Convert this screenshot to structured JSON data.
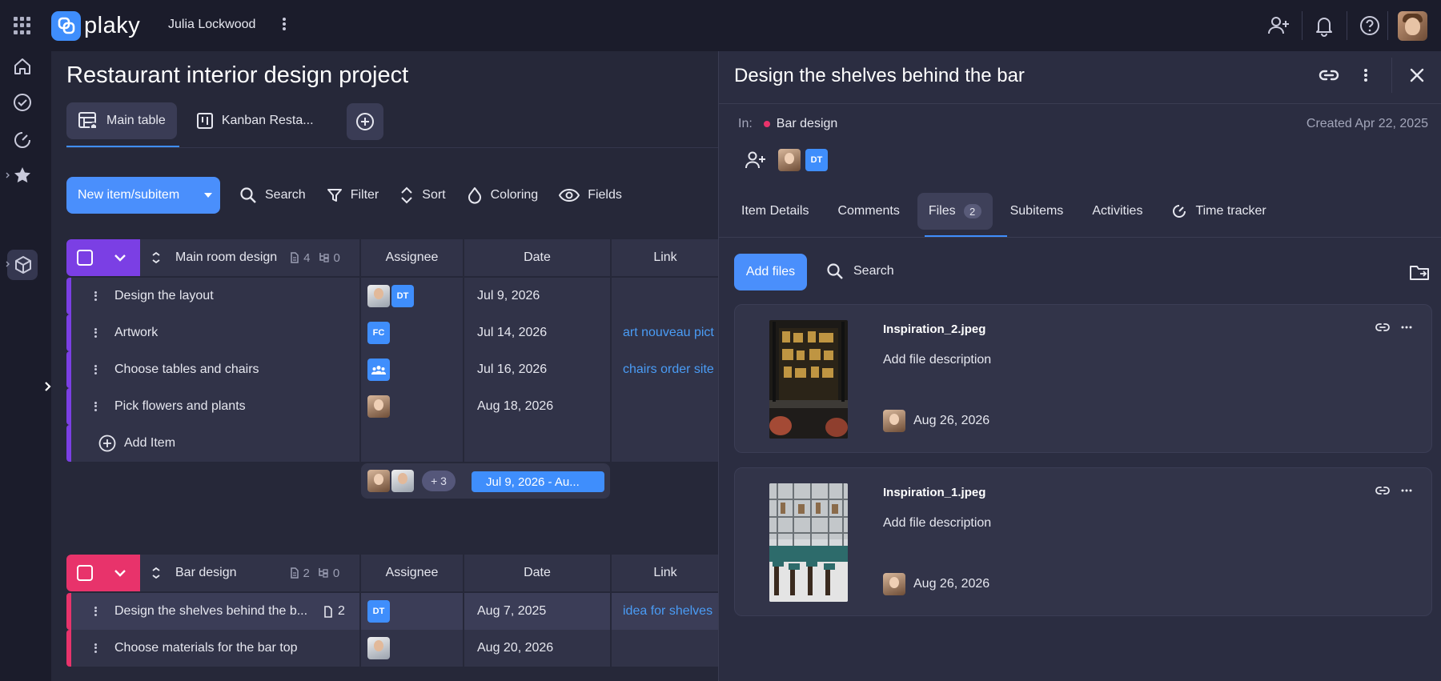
{
  "app": {
    "brand": "plaky",
    "user_name": "Julia Lockwood"
  },
  "project": {
    "title": "Restaurant interior design project",
    "tabs": [
      {
        "label": "Main table"
      },
      {
        "label": "Kanban Resta..."
      }
    ]
  },
  "toolbar": {
    "new_item": "New item/subitem",
    "search": "Search",
    "filter": "Filter",
    "sort": "Sort",
    "coloring": "Coloring",
    "fields": "Fields"
  },
  "columns": {
    "assignee": "Assignee",
    "date": "Date",
    "link": "Link"
  },
  "groups": [
    {
      "name": "Main room design",
      "color": "#7b3fe4",
      "items_count": "4",
      "subitems_count": "0",
      "rows": [
        {
          "name": "Design the layout",
          "date": "Jul 9, 2026",
          "link": "",
          "assignees": [
            "photo2",
            "DT"
          ]
        },
        {
          "name": "Artwork",
          "date": "Jul 14, 2026",
          "link": "art nouveau pict",
          "assignees": [
            "FC"
          ]
        },
        {
          "name": "Choose tables and chairs",
          "date": "Jul 16, 2026",
          "link": "chairs order site",
          "assignees": [
            "team"
          ]
        },
        {
          "name": "Pick flowers and plants",
          "date": "Aug 18, 2026",
          "link": "",
          "assignees": [
            "photo"
          ]
        }
      ],
      "add_item": "Add Item",
      "summary_more": "+ 3",
      "summary_dates": "Jul 9, 2026 - Au..."
    },
    {
      "name": "Bar design",
      "color": "#e8336b",
      "items_count": "2",
      "subitems_count": "0",
      "rows": [
        {
          "name": "Design the shelves behind the b...",
          "files": "2",
          "date": "Aug 7, 2025",
          "link": "idea for shelves",
          "assignees": [
            "DT"
          ]
        },
        {
          "name": "Choose materials for the bar top",
          "date": "Aug 20, 2026",
          "link": "",
          "assignees": [
            "photo2"
          ]
        }
      ]
    }
  ],
  "panel": {
    "title": "Design the shelves behind the bar",
    "in_label": "In:",
    "group": "Bar design",
    "created": "Created Apr 22, 2025",
    "member_initials": "DT",
    "tabs": [
      {
        "label": "Item Details"
      },
      {
        "label": "Comments"
      },
      {
        "label": "Files",
        "count": "2"
      },
      {
        "label": "Subitems"
      },
      {
        "label": "Activities"
      },
      {
        "label": "Time tracker"
      }
    ],
    "add_files": "Add files",
    "search": "Search",
    "files": [
      {
        "name": "Inspiration_2.jpeg",
        "description": "Add file description",
        "date": "Aug 26, 2026"
      },
      {
        "name": "Inspiration_1.jpeg",
        "description": "Add file description",
        "date": "Aug 26, 2026"
      }
    ]
  },
  "colors": {
    "accent": "#3f8efc",
    "link": "#4a9cf5",
    "group_purple": "#7b3fe4",
    "group_pink": "#e8336b"
  }
}
